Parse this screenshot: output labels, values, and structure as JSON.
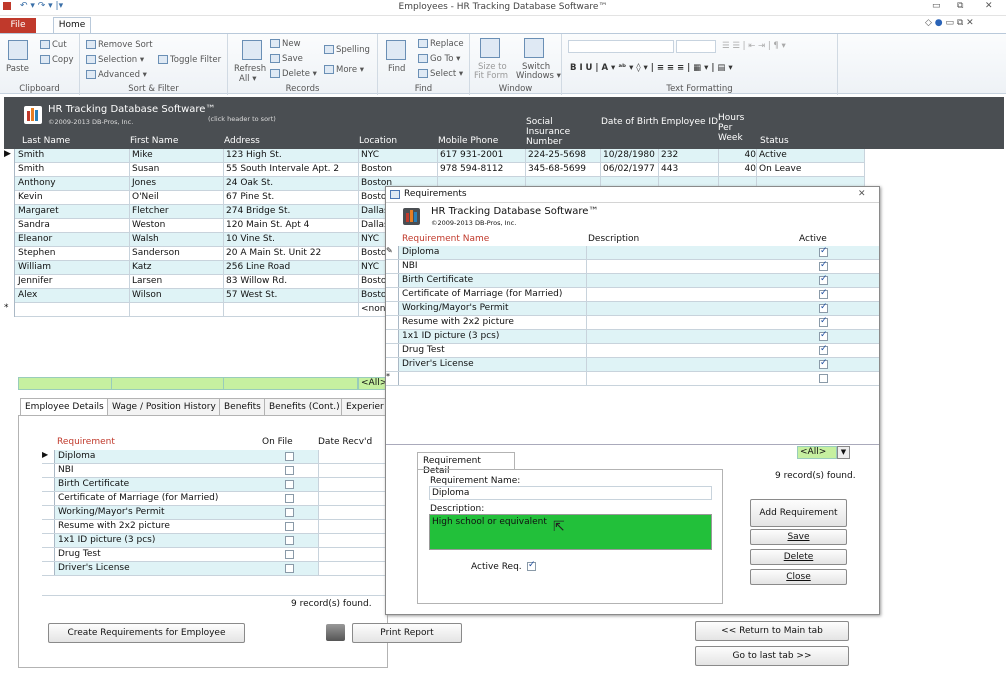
{
  "window": {
    "title": "Employees - HR Tracking Database Software™"
  },
  "ribbon": {
    "tabs": [
      "File",
      "Home"
    ],
    "clipboard": {
      "label": "Clipboard",
      "paste": "Paste",
      "cut": "Cut",
      "copy": "Copy"
    },
    "sortfilter": {
      "label": "Sort & Filter",
      "remove_sort": "Remove Sort",
      "selection": "Selection ▾",
      "toggle": "Toggle Filter",
      "advanced": "Advanced ▾"
    },
    "records": {
      "label": "Records",
      "refresh": "Refresh",
      "refresh2": "All ▾",
      "new": "New",
      "save": "Save",
      "delete": "Delete ▾",
      "spelling": "Spelling",
      "more": "More ▾"
    },
    "find": {
      "label": "Find",
      "find": "Find",
      "replace": "Replace",
      "goto": "Go To ▾",
      "select": "Select ▾"
    },
    "window_grp": {
      "label": "Window",
      "size": "Size to",
      "size2": "Fit Form",
      "switch": "Switch",
      "switch2": "Windows ▾"
    },
    "text": {
      "label": "Text Formatting"
    }
  },
  "app_header": {
    "name": "HR Tracking Database Software™",
    "copyright": "©2009-2013 DB-Pros, Inc.",
    "hint": "(click header to sort)"
  },
  "columns": [
    "Last Name",
    "First Name",
    "Address",
    "Location",
    "Mobile Phone",
    "Social Insurance Number",
    "Date of Birth",
    "Employee ID",
    "Hours Per Week",
    "Status"
  ],
  "employees": [
    [
      "Smith",
      "Mike",
      "123 High St.",
      "NYC",
      "617 931-2001",
      "224-25-5698",
      "10/28/1980",
      "232",
      "40",
      "Active"
    ],
    [
      "Smith",
      "Susan",
      "55 South Intervale Apt. 2",
      "Boston",
      "978 594-8112",
      "345-68-5699",
      "06/02/1977",
      "443",
      "40",
      "On Leave"
    ],
    [
      "Anthony",
      "Jones",
      "24 Oak St.",
      "Boston",
      "",
      "",
      "",
      "",
      "",
      ""
    ],
    [
      "Kevin",
      "O'Neil",
      "67 Pine St.",
      "Boston",
      "",
      "",
      "",
      "",
      "",
      ""
    ],
    [
      "Margaret",
      "Fletcher",
      "274 Bridge St.",
      "Dallas",
      "",
      "",
      "",
      "",
      "",
      ""
    ],
    [
      "Sandra",
      "Weston",
      "120 Main St. Apt 4",
      "Dallas",
      "",
      "",
      "",
      "",
      "",
      ""
    ],
    [
      "Eleanor",
      "Walsh",
      "10 Vine St.",
      "NYC",
      "",
      "",
      "",
      "",
      "",
      ""
    ],
    [
      "Stephen",
      "Sanderson",
      "20 A Main St. Unit 22",
      "Boston",
      "",
      "",
      "",
      "",
      "",
      ""
    ],
    [
      "William",
      "Katz",
      "256 Line Road",
      "NYC",
      "",
      "",
      "",
      "",
      "",
      ""
    ],
    [
      "Jennifer",
      "Larsen",
      "83 Willow Rd.",
      "Boston",
      "",
      "",
      "",
      "",
      "",
      ""
    ],
    [
      "Alex",
      "Wilson",
      "57 West St.",
      "Boston",
      "",
      "",
      "",
      "",
      "",
      ""
    ]
  ],
  "new_row_location": "<non",
  "filter_all": "<All>",
  "subtabs": [
    "Employee Details",
    "Wage / Position History",
    "Benefits",
    "Benefits (Cont.)",
    "Experier"
  ],
  "req_panel": {
    "headers": {
      "req": "Requirement",
      "onfile": "On File",
      "date": "Date Recv'd"
    },
    "items": [
      "Diploma",
      "NBI",
      "Birth Certificate",
      "Certificate of Marriage (for Married)",
      "Working/Mayor's Permit",
      "Resume with 2x2 picture",
      "1x1 ID picture (3 pcs)",
      "Drug Test",
      "Driver's License"
    ],
    "count": "9 record(s) found."
  },
  "buttons": {
    "create": "Create Requirements for Employee",
    "print": "Print Report",
    "return": "<< Return to Main tab",
    "last": "Go to last tab >>"
  },
  "dialog": {
    "title": "Requirements",
    "app_name": "HR Tracking Database Software™",
    "copyright": "©2009-2013 DB-Pros, Inc.",
    "headers": {
      "name": "Requirement Name",
      "desc": "Description",
      "active": "Active"
    },
    "items": [
      "Diploma",
      "NBI",
      "Birth Certificate",
      "Certificate of Marriage (for Married)",
      "Working/Mayor's Permit",
      "Resume with 2x2 picture",
      "1x1 ID picture (3 pcs)",
      "Drug Test",
      "Driver's License"
    ],
    "filter": "<All>",
    "detail_tab": "Requirement Detail",
    "name_label": "Requirement Name:",
    "name_value": "Diploma",
    "desc_label": "Description:",
    "desc_value": "High school or equivalent",
    "active_label": "Active Req.",
    "count": "9 record(s) found.",
    "add": "Add Requirement",
    "save": "Save",
    "delete": "Delete",
    "close": "Close"
  },
  "colors": {
    "accent": "#c0392b",
    "row": "#dff3f6",
    "filter": "#c6f0a0",
    "desc": "#22c03a",
    "header": "#4a4e52"
  }
}
